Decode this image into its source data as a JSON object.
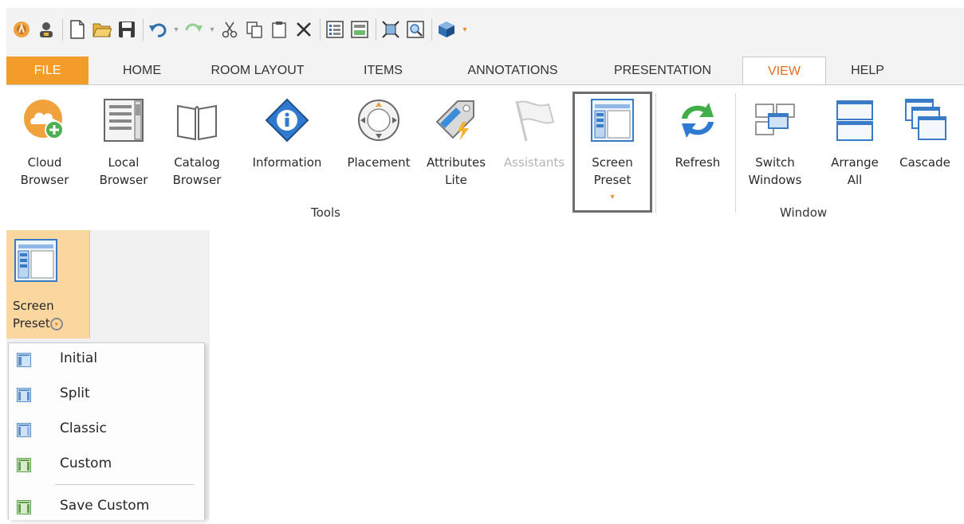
{
  "ribbon": {
    "tabs": [
      "FILE",
      "HOME",
      "ROOM LAYOUT",
      "ITEMS",
      "ANNOTATIONS",
      "PRESENTATION",
      "VIEW",
      "HELP"
    ],
    "active_tab": "VIEW",
    "tools_buttons": [
      {
        "line1": "Cloud",
        "line2": "Browser"
      },
      {
        "line1": "Local",
        "line2": "Browser"
      },
      {
        "line1": "Catalog",
        "line2": "Browser"
      },
      {
        "line1": "Information",
        "line2": ""
      },
      {
        "line1": "Placement",
        "line2": ""
      },
      {
        "line1": "Attributes",
        "line2": "Lite"
      },
      {
        "line1": "Assistants",
        "line2": ""
      },
      {
        "line1": "Screen",
        "line2": "Preset"
      }
    ],
    "refresh_label": "Refresh",
    "window_buttons": [
      {
        "line1": "Switch",
        "line2": "Windows"
      },
      {
        "line1": "Arrange",
        "line2": "All"
      },
      {
        "line1": "Cascade",
        "line2": ""
      }
    ],
    "group_tools": "Tools",
    "group_window": "Window",
    "dropdown_caret": "▾"
  },
  "screen_preset": {
    "line1": "Screen",
    "line2": "Preset",
    "menu_items": [
      "Initial",
      "Split",
      "Classic",
      "Custom",
      "Save Custom"
    ]
  },
  "colors": {
    "file_tab": "#f39c28",
    "active_tab_text": "#e66f1f",
    "highlight_button_bg": "#fbd7a0"
  }
}
